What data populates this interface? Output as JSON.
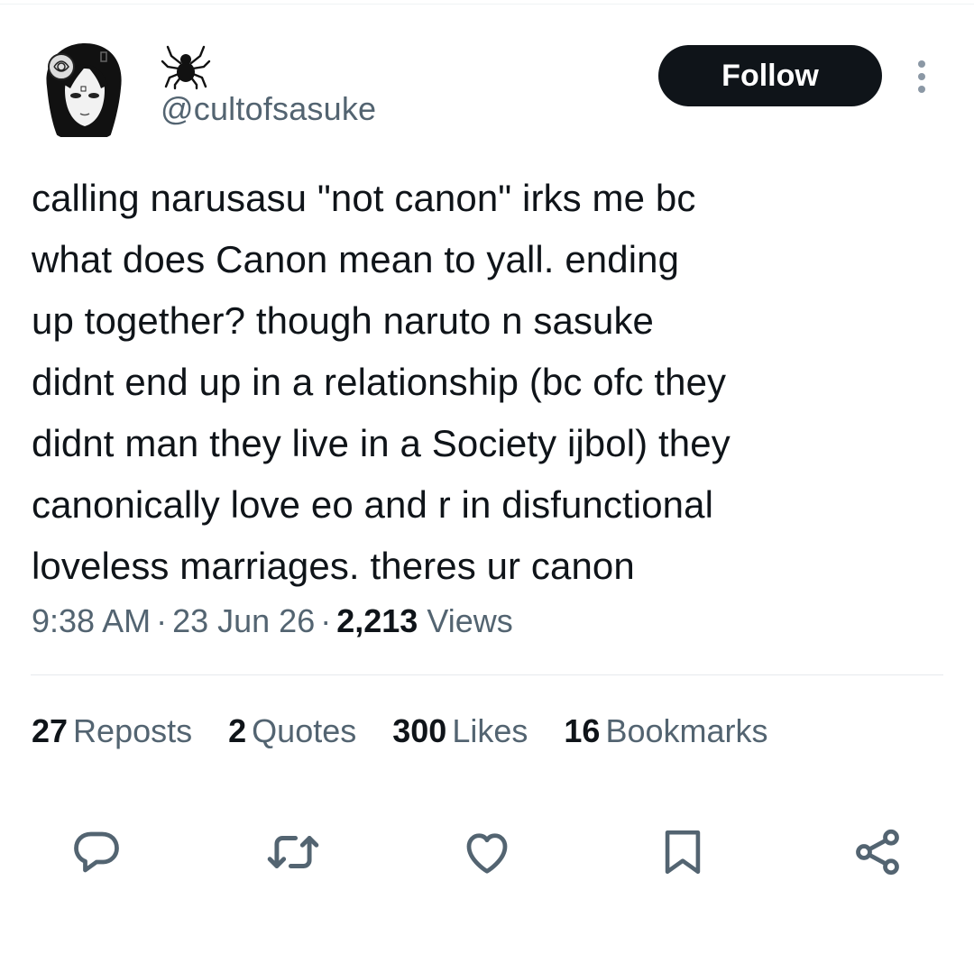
{
  "author": {
    "handle": "@cultofsasuke",
    "display_name_icon": "spider-icon",
    "avatar_icon": "anime-character-avatar"
  },
  "follow_label": "Follow",
  "tweet": {
    "lines": [
      "calling narusasu \"not canon\" irks me bc",
      "what does Canon mean to yall. ending",
      "up together? though naruto n sasuke",
      "didnt end up in a relationship (bc ofc they",
      "didnt man they live in a Society ijbol) they",
      "canonically love eo and r in disfunctional",
      "loveless marriages. theres ur canon"
    ]
  },
  "meta": {
    "time": "9:38 AM",
    "date": "23 Jun 26",
    "views_count": "2,213",
    "views_label": "Views",
    "separator": "·"
  },
  "stats": {
    "reposts_count": "27",
    "reposts_label": "Reposts",
    "quotes_count": "2",
    "quotes_label": "Quotes",
    "likes_count": "300",
    "likes_label": "Likes",
    "bookmarks_count": "16",
    "bookmarks_label": "Bookmarks"
  },
  "actions": [
    "reply-icon",
    "repost-icon",
    "like-icon",
    "bookmark-icon",
    "share-icon"
  ],
  "colors": {
    "text": "#0f1419",
    "secondary": "#536471",
    "button_bg": "#0f1419",
    "button_text": "#ffffff"
  }
}
